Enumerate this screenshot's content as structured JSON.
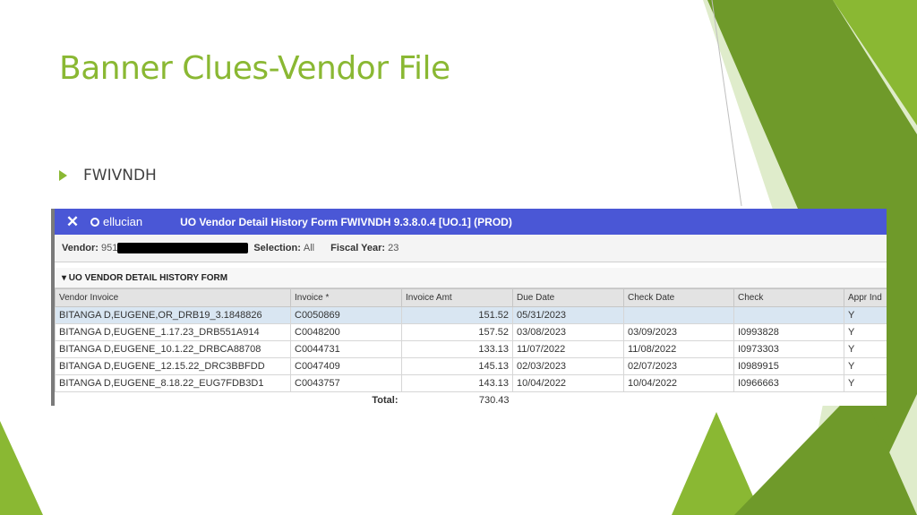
{
  "slide": {
    "title": "Banner Clues-Vendor File",
    "bullet": "FWIVNDH"
  },
  "window": {
    "close_icon": "close-icon",
    "brand": "ellucian",
    "title": "UO Vendor Detail History Form FWIVNDH 9.3.8.0.4 [UO.1] (PROD)"
  },
  "key_block": {
    "vendor_label": "Vendor:",
    "vendor_value": "951",
    "selection_label": "Selection:",
    "selection_value": "All",
    "fiscal_year_label": "Fiscal Year:",
    "fiscal_year_value": "23"
  },
  "section": {
    "title": "▾ UO VENDOR DETAIL HISTORY FORM"
  },
  "table": {
    "headers": [
      "Vendor Invoice",
      "Invoice *",
      "Invoice Amt",
      "Due Date",
      "Check Date",
      "Check",
      "Appr Ind"
    ],
    "rows": [
      [
        "BITANGA D,EUGENE,OR_DRB19_3.1848826",
        "C0050869",
        "151.52",
        "05/31/2023",
        "",
        "",
        "Y"
      ],
      [
        "BITANGA D,EUGENE_1.17.23_DRB551A914",
        "C0048200",
        "157.52",
        "03/08/2023",
        "03/09/2023",
        "I0993828",
        "Y"
      ],
      [
        "BITANGA D,EUGENE_10.1.22_DRBCA88708",
        "C0044731",
        "133.13",
        "11/07/2022",
        "11/08/2022",
        "I0973303",
        "Y"
      ],
      [
        "BITANGA D,EUGENE_12.15.22_DRC3BBFDD",
        "C0047409",
        "145.13",
        "02/03/2023",
        "02/07/2023",
        "I0989915",
        "Y"
      ],
      [
        "BITANGA D,EUGENE_8.18.22_EUG7FDB3D1",
        "C0043757",
        "143.13",
        "10/04/2022",
        "10/04/2022",
        "I0966663",
        "Y"
      ]
    ],
    "total_label": "Total:",
    "total_value": "730.43"
  },
  "colors": {
    "accent_green": "#8ab833",
    "titlebar_blue": "#4a57d6",
    "selected_row": "#d9e6f2"
  }
}
